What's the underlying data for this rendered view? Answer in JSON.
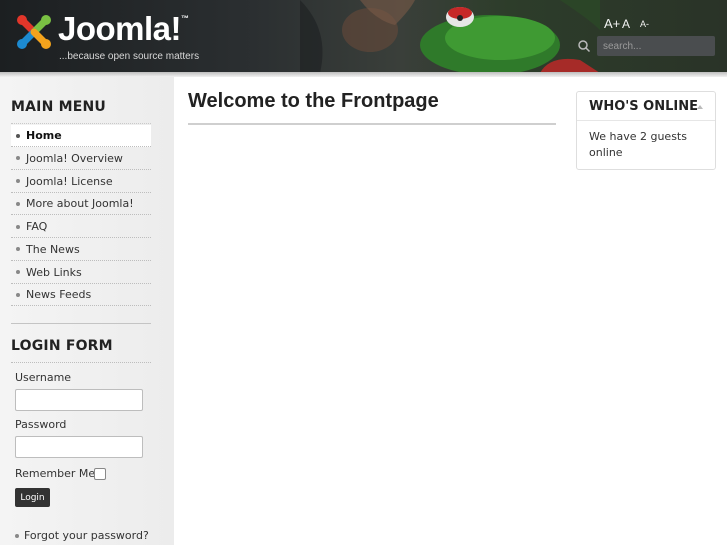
{
  "header": {
    "logo_text": "Joomla!",
    "logo_tm": "™",
    "tagline": "...because open source matters",
    "font_size_tools": {
      "increase": "A+",
      "reset": "A",
      "decrease": "A-"
    },
    "search": {
      "placeholder": "search...",
      "value": ""
    }
  },
  "sidebar": {
    "main_menu": {
      "title": "MAIN MENU",
      "items": [
        {
          "label": "Home",
          "active": true
        },
        {
          "label": "Joomla! Overview"
        },
        {
          "label": "Joomla! License"
        },
        {
          "label": "More about Joomla!"
        },
        {
          "label": "FAQ"
        },
        {
          "label": "The News"
        },
        {
          "label": "Web Links"
        },
        {
          "label": "News Feeds"
        }
      ]
    },
    "login_form": {
      "title": "LOGIN FORM",
      "username_label": "Username",
      "username_value": "",
      "password_label": "Password",
      "password_value": "",
      "remember_label": "Remember Me",
      "remember_checked": false,
      "login_button": "Login",
      "forgot_password": "Forgot your password?"
    }
  },
  "main": {
    "title": "Welcome to the Frontpage"
  },
  "whos_online": {
    "title": "WHO'S ONLINE",
    "text": "We have 2 guests online"
  },
  "colors": {
    "header_bg": "#2b2f31",
    "sidebar_bg": "#f0f0f0",
    "button_bg": "#333333",
    "logo_red": "#e2362a",
    "logo_green": "#7ac143",
    "logo_blue": "#1c8ad1",
    "logo_orange": "#f4a31c"
  },
  "icons": [
    "joomla-logo-icon",
    "search-icon",
    "bullet-icon",
    "collapse-arrow-icon"
  ]
}
